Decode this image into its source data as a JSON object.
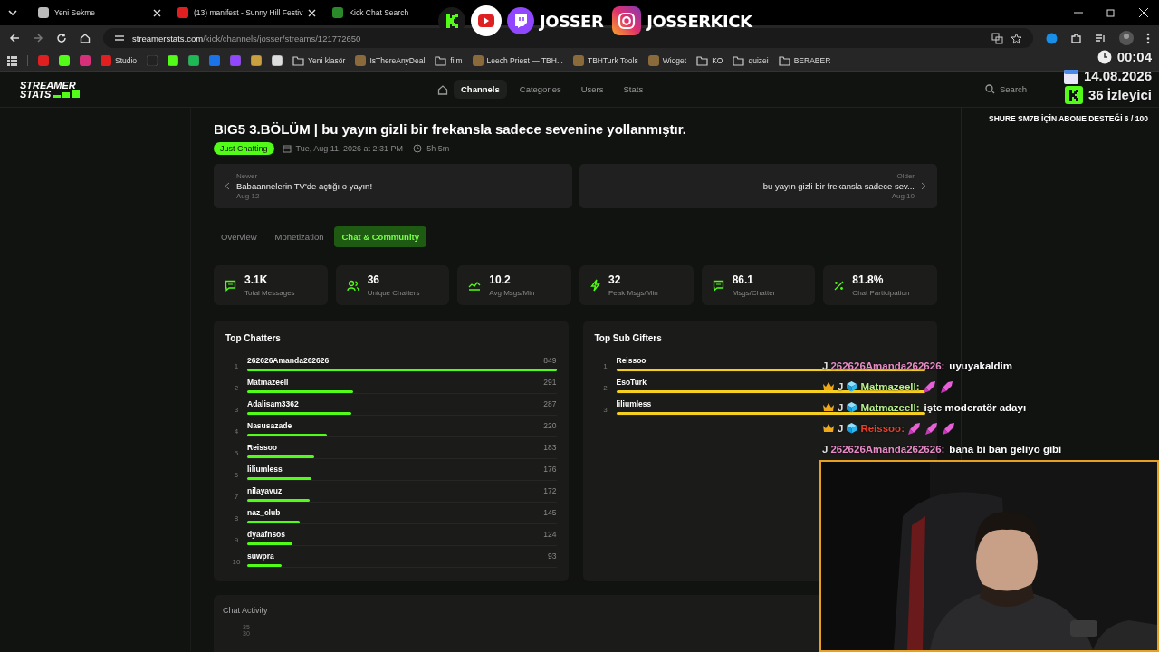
{
  "browser": {
    "tabs": [
      {
        "title": "Yeni Sekme",
        "selected": false
      },
      {
        "title": "(13) manifest - Sunny Hill Festiv",
        "selected": false
      },
      {
        "title": "Kick Chat Search",
        "selected": false
      }
    ],
    "url_host": "streamerstats.com",
    "url_path": "/kick/channels/josser/streams/121772650",
    "bookmarks": [
      {
        "label": "Studio",
        "folder": false
      },
      {
        "label": "Yeni klasör",
        "folder": true
      },
      {
        "label": "IsThereAnyDeal",
        "folder": false
      },
      {
        "label": "film",
        "folder": true
      },
      {
        "label": "Leech Priest — TBH...",
        "folder": false
      },
      {
        "label": "TBHTurk Tools",
        "folder": false
      },
      {
        "label": "Widget",
        "folder": false
      },
      {
        "label": "KO",
        "folder": true
      },
      {
        "label": "quizei",
        "folder": true
      },
      {
        "label": "BERABER",
        "folder": true
      }
    ]
  },
  "site": {
    "logo": [
      "STREAMER",
      "STATS"
    ],
    "nav": [
      {
        "label": "Channels",
        "selected": true
      },
      {
        "label": "Categories",
        "selected": false
      },
      {
        "label": "Users",
        "selected": false
      },
      {
        "label": "Stats",
        "selected": false
      }
    ],
    "search": "Search",
    "title": "BIG5 3.BÖLÜM | bu yayın gizli bir frekansla sadece sevenine yollanmıştır.",
    "category": "Just Chatting",
    "date": "Tue, Aug 11, 2026 at 2:31 PM",
    "duration": "5h 5m",
    "neighbors": [
      {
        "kind": "newer",
        "caption": "Newer",
        "title": "Babaannelerin TV'de açtığı o yayın!",
        "date": "Aug 12"
      },
      {
        "kind": "older",
        "caption": "Older",
        "title": "bu yayın gizli bir frekansla sadece sev...",
        "date": "Aug 10"
      }
    ],
    "tabs": [
      {
        "label": "Overview",
        "selected": false
      },
      {
        "label": "Monetization",
        "selected": false
      },
      {
        "label": "Chat & Community",
        "selected": true
      }
    ],
    "stats": [
      {
        "kind": "messages",
        "value": "3.1K",
        "label": "Total Messages"
      },
      {
        "kind": "users",
        "value": "36",
        "label": "Unique Chatters"
      },
      {
        "kind": "trend",
        "value": "10.2",
        "label": "Avg Msgs/Min"
      },
      {
        "kind": "bolt",
        "value": "32",
        "label": "Peak Msgs/Min"
      },
      {
        "kind": "messages",
        "value": "86.1",
        "label": "Msgs/Chatter"
      },
      {
        "kind": "percent",
        "value": "81.8%",
        "label": "Chat Participation"
      }
    ],
    "top_chatters": {
      "title": "Top Chatters",
      "rows": [
        {
          "rank": "1",
          "name": "262626Amanda262626",
          "count": "849",
          "level": 1
        },
        {
          "rank": "2",
          "name": "Matmazeell",
          "count": "291",
          "level": 0.343
        },
        {
          "rank": "3",
          "name": "Adalisam3362",
          "count": "287",
          "level": 0.338
        },
        {
          "rank": "4",
          "name": "Nasusazade",
          "count": "220",
          "level": 0.259
        },
        {
          "rank": "5",
          "name": "Reissoo",
          "count": "183",
          "level": 0.216
        },
        {
          "rank": "6",
          "name": "liliumless",
          "count": "176",
          "level": 0.207
        },
        {
          "rank": "7",
          "name": "nilayavuz",
          "count": "172",
          "level": 0.203
        },
        {
          "rank": "8",
          "name": "naz_club",
          "count": "145",
          "level": 0.171
        },
        {
          "rank": "9",
          "name": "dyaafnsos",
          "count": "124",
          "level": 0.146
        },
        {
          "rank": "10",
          "name": "suwpra",
          "count": "93",
          "level": 0.11
        }
      ]
    },
    "top_gifters": {
      "title": "Top Sub Gifters",
      "rows": [
        {
          "rank": "1",
          "name": "Reissoo",
          "level": 1
        },
        {
          "rank": "2",
          "name": "EsoTurk",
          "level": 1
        },
        {
          "rank": "3",
          "name": "liliumless",
          "level": 1
        }
      ]
    },
    "chat_activity": {
      "title": "Chat Activity",
      "ticks": [
        "35",
        "30"
      ]
    }
  },
  "overlay": {
    "socials": [
      {
        "kind": "kick"
      },
      {
        "kind": "youtube"
      },
      {
        "kind": "twitch",
        "label": "JOSSER"
      },
      {
        "kind": "instagram",
        "label": "JOSSERKICK"
      }
    ],
    "clock": "00:04",
    "date": "14.08.2026",
    "viewers": "36 İzleyici",
    "goal": "SHURE SM7B İÇİN ABONE DESTEĞİ 6 / 100",
    "chat": [
      {
        "user": "262626Amanda262626:",
        "color": "#e88cc8",
        "badges": [
          {
            "kind": "letter",
            "text": "J"
          }
        ],
        "parts": [
          {
            "kind": "text",
            "text": "uyuyakaldim"
          }
        ]
      },
      {
        "user": "Matmazeell:",
        "color": "#b8f08a",
        "badges": [
          {
            "kind": "crown"
          },
          {
            "kind": "letter",
            "text": "J"
          },
          {
            "kind": "cube"
          }
        ],
        "parts": [
          {
            "kind": "emote"
          },
          {
            "kind": "emote"
          }
        ]
      },
      {
        "user": "Matmazeell:",
        "color": "#b8f08a",
        "badges": [
          {
            "kind": "crown"
          },
          {
            "kind": "letter",
            "text": "J"
          },
          {
            "kind": "cube"
          }
        ],
        "parts": [
          {
            "kind": "text",
            "text": "işte moderatör adayı"
          }
        ]
      },
      {
        "user": "Reissoo:",
        "color": "#e8402a",
        "badges": [
          {
            "kind": "crown"
          },
          {
            "kind": "letter",
            "text": "J"
          },
          {
            "kind": "cube"
          }
        ],
        "parts": [
          {
            "kind": "emote"
          },
          {
            "kind": "emote"
          },
          {
            "kind": "emote"
          }
        ]
      },
      {
        "user": "262626Amanda262626:",
        "color": "#e88cc8",
        "badges": [
          {
            "kind": "letter",
            "text": "J"
          }
        ],
        "parts": [
          {
            "kind": "text",
            "text": "bana bi ban geliyo gibi"
          }
        ]
      }
    ]
  }
}
